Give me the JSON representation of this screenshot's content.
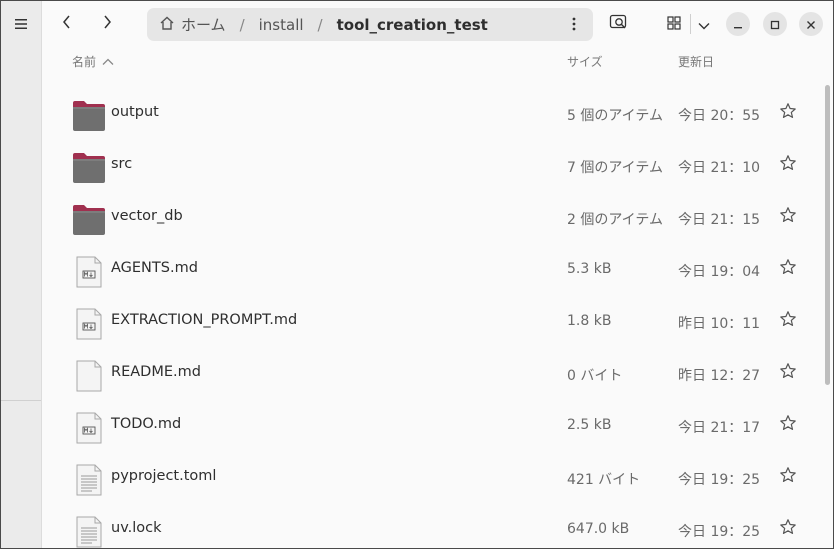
{
  "path": {
    "home_label": "ホーム",
    "segments": [
      "install",
      "tool_creation_test"
    ]
  },
  "columns": {
    "name": "名前",
    "size": "サイズ",
    "modified": "更新日"
  },
  "files": [
    {
      "name": "output",
      "kind": "folder",
      "size": "5 個のアイテム",
      "modified": "今日 20：55"
    },
    {
      "name": "src",
      "kind": "folder",
      "size": "7 個のアイテム",
      "modified": "今日 21：10"
    },
    {
      "name": "vector_db",
      "kind": "folder",
      "size": "2 個のアイテム",
      "modified": "今日 21：15"
    },
    {
      "name": "AGENTS.md",
      "kind": "markdown",
      "size": "5.3 kB",
      "modified": "今日 19：04"
    },
    {
      "name": "EXTRACTION_PROMPT.md",
      "kind": "markdown",
      "size": "1.8 kB",
      "modified": "昨日 10：11"
    },
    {
      "name": "README.md",
      "kind": "empty",
      "size": "0 バイト",
      "modified": "昨日 12：27"
    },
    {
      "name": "TODO.md",
      "kind": "markdown",
      "size": "2.5 kB",
      "modified": "今日 21：17"
    },
    {
      "name": "pyproject.toml",
      "kind": "text",
      "size": "421 バイト",
      "modified": "今日 19：25"
    },
    {
      "name": "uv.lock",
      "kind": "text",
      "size": "647.0 kB",
      "modified": "今日 19：25"
    }
  ],
  "icons": {
    "menu": "hamburger-menu-icon",
    "back": "chevron-left-icon",
    "forward": "chevron-right-icon",
    "home": "home-icon",
    "more": "kebab-menu-icon",
    "search": "search-icon",
    "view": "grid-view-icon",
    "view_options": "chevron-down-icon",
    "minimize": "minimize-icon",
    "maximize": "maximize-icon",
    "close": "close-icon",
    "star": "star-icon",
    "sort": "sort-ascending-icon"
  },
  "colors": {
    "folder_tab": "#a0304f",
    "folder_body": "#6f6f6f",
    "accent": "#2e2e2e"
  }
}
